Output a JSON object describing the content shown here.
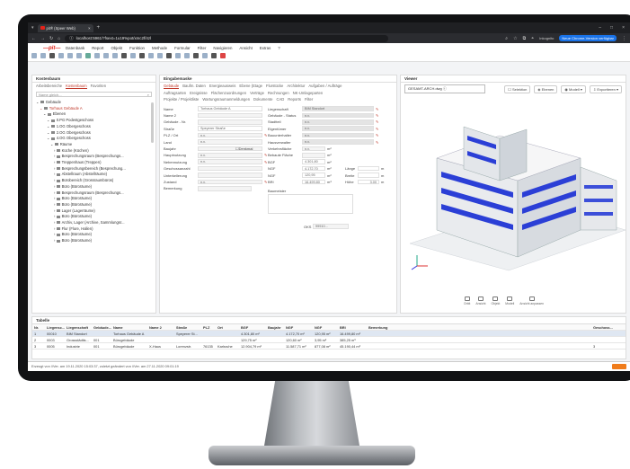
{
  "browser": {
    "tab_title": "pit® (Speer Web)",
    "url": "localhost:5961/?fsext=1u19%pot/xmc2f/4zl",
    "incognito_label": "Inkognito",
    "update_label": "Neue Chrome-Version verfügbar"
  },
  "app": {
    "logo": "—pit—",
    "menu": [
      "Datenbank",
      "Report",
      "Objekt",
      "Funktion",
      "Methode",
      "Formular",
      "Filter",
      "Navigieren",
      "Ansicht",
      "Extras",
      "?"
    ]
  },
  "left_panel": {
    "title": "Kostenbaum",
    "tabs": [
      "Arbeitsbereiche",
      "Kostenbaum",
      "Favoriten"
    ],
    "search_placeholder": "Name gleich...",
    "tree": [
      {
        "label": "Gebäude",
        "level": 0
      },
      {
        "label": "Torhaus Gebäude A",
        "level": 1,
        "selected": true
      },
      {
        "label": "Ebenen",
        "level": 2
      },
      {
        "label": "0.PG Podestgeschoss",
        "level": 3
      },
      {
        "label": "1.OG Obergeschoss",
        "level": 3
      },
      {
        "label": "2.OG Obergeschoss",
        "level": 3
      },
      {
        "label": "4.OG Obergeschoss",
        "level": 3
      },
      {
        "label": "Räume",
        "level": 4
      },
      {
        "label": "Küche (Küchen)",
        "level": 5
      },
      {
        "label": "Besprechungsraum (Besprechungs...",
        "level": 5
      },
      {
        "label": "Treppenhaus (Treppen)",
        "level": 5
      },
      {
        "label": "Besprechungsbereich (Besprechung...",
        "level": 5
      },
      {
        "label": "Abstellraum (Abstellräume)",
        "level": 5
      },
      {
        "label": "Bürobereich (Grossraumbüros)",
        "level": 5
      },
      {
        "label": "Büro (Büroräume)",
        "level": 5
      },
      {
        "label": "Besprechungsraum (Besprechungs...",
        "level": 5
      },
      {
        "label": "Büro (Büroräume)",
        "level": 5
      },
      {
        "label": "Büro (Büroräume)",
        "level": 5
      },
      {
        "label": "Lager (Lagerräume)",
        "level": 5
      },
      {
        "label": "Büro (Büroräume)",
        "level": 5
      },
      {
        "label": "Archiv, Lager (Archive, Sammlungsr...",
        "level": 5
      },
      {
        "label": "Flur (Flure, Hallen)",
        "level": 5
      },
      {
        "label": "Büro (Büroräume)",
        "level": 5
      },
      {
        "label": "Büro (Büroräume)",
        "level": 5
      }
    ]
  },
  "center_panel": {
    "title": "Eingabemaske",
    "tabs_row1": [
      "Gebäude",
      "Baufm. Daten",
      "Energieausweis",
      "Ebene (Etage",
      "Flurstücke",
      "Architektur",
      "Aufgaben / Aufträge"
    ],
    "tabs_row2": [
      "Auftragsarten",
      "Ereignisse",
      "Flächenzuordnungen",
      "Verträge",
      "Rechnungen",
      "NK-Umlageparten"
    ],
    "tabs_row3": [
      "Projekte / Projektliste",
      "Wartungsraumanmeldungen",
      "Dokumente",
      "CAD",
      "Reports",
      "Filter"
    ],
    "left_fields": [
      {
        "label": "Name",
        "value": "Torhaus Gebäude A"
      },
      {
        "label": "Name 2",
        "value": ""
      },
      {
        "label": "Gebäude - Nr.",
        "value": ""
      },
      {
        "label": "Straße",
        "value": "Speyerer Straße"
      },
      {
        "label": "PLZ / Ort",
        "value": "n.v."
      },
      {
        "label": "Land",
        "value": "n.v."
      },
      {
        "label": "Baujahr",
        "value": ""
      },
      {
        "label": "Hauptnutzung",
        "value": "n.v."
      },
      {
        "label": "Nebennutzung",
        "value": "n.v."
      },
      {
        "label": "Geschossanzahl",
        "value": ""
      },
      {
        "label": "Unterkellerung",
        "value": ""
      },
      {
        "label": "Zustand",
        "value": "n.v."
      },
      {
        "label": "Bemerkung",
        "value": ""
      }
    ],
    "denkmal_label": "Denkmal",
    "right_fields": [
      {
        "label": "Liegenschaft",
        "value": "BIM Standort"
      },
      {
        "label": "Gebäude - Status",
        "value": "n.v."
      },
      {
        "label": "Stadtteil",
        "value": "n.v."
      },
      {
        "label": "Eigentümer",
        "value": "n.v."
      },
      {
        "label": "Bauunterhalter",
        "value": "n.v."
      },
      {
        "label": "Hausverwalter",
        "value": "n.v."
      }
    ],
    "area_fields": [
      {
        "label": "Verkehrsfläche",
        "value": "n.v.",
        "unit": "m²"
      },
      {
        "label": "Bebaute Fläche",
        "value": "",
        "unit": "m²"
      },
      {
        "label": "BGF",
        "value": "4.301,80",
        "unit": "m²"
      },
      {
        "label": "NGF",
        "value": "4.172,70",
        "unit": "m²"
      },
      {
        "label": "NGF",
        "value": "120,95",
        "unit": "m²"
      },
      {
        "label": "BRI",
        "value": "16.499,80",
        "unit": "m³"
      }
    ],
    "dims": [
      {
        "label": "Länge",
        "value": "",
        "unit": "m"
      },
      {
        "label": "Breite",
        "value": "",
        "unit": "m"
      },
      {
        "label": "Höhe",
        "value": "3,00",
        "unit": "m"
      }
    ],
    "baumeister_label": "Baumeister",
    "oks_label": "OKS",
    "oks_value": "99910..."
  },
  "viewer": {
    "title": "Viewer",
    "model_select": "GESAMT-ARCH.dwg",
    "buttons": [
      "Selektion",
      "Ebenen",
      "Modell",
      "Exportieren"
    ],
    "nav_labels": [
      "Orbit",
      "Ansicht",
      "Objekt",
      "Modell",
      "Ansicht anpassen"
    ]
  },
  "table": {
    "title": "Tabelle",
    "headers": [
      "Nr.",
      "Liegensc...",
      "Liegenschaft",
      "Gebäude-...",
      "Name",
      "Name 2",
      "Straße",
      "PLZ",
      "Ort",
      "BGF",
      "Baujahr",
      "NGF",
      "NGF",
      "BRI",
      "Bemerkung",
      "Geschoss..."
    ],
    "rows": [
      [
        "1",
        "00010",
        "BIM Standort",
        "",
        "Torhaus Gebäude A",
        "",
        "Speyerer St...",
        "",
        "",
        "4.301,80 m²",
        "",
        "4.172,70 m²",
        "120,95 m²",
        "16.499,80 m³",
        "",
        ""
      ],
      [
        "2",
        "0003",
        "Grossstädtis...",
        "001",
        "Bürogebäude",
        "",
        "",
        "",
        "",
        "129,75 m²",
        "",
        "120,60 m²",
        "3,95 m²",
        "385,25 m³",
        "",
        ""
      ],
      [
        "3",
        "0005",
        "Industrie",
        "001",
        "Bürogebäude",
        "X-Haus",
        "Lorenzstr.",
        "76135",
        "Karlsruhe",
        "12.904,79 m²",
        "",
        "11.587,71 m²",
        "877,08 m²",
        "45.190,44 m³",
        "",
        "3"
      ]
    ]
  },
  "status": {
    "text": "Erzeugt von //Ver. am 19.11.2020 15:03:37, zuletzt geändert von //Ver. am 27.11.2020 09:01:19"
  }
}
